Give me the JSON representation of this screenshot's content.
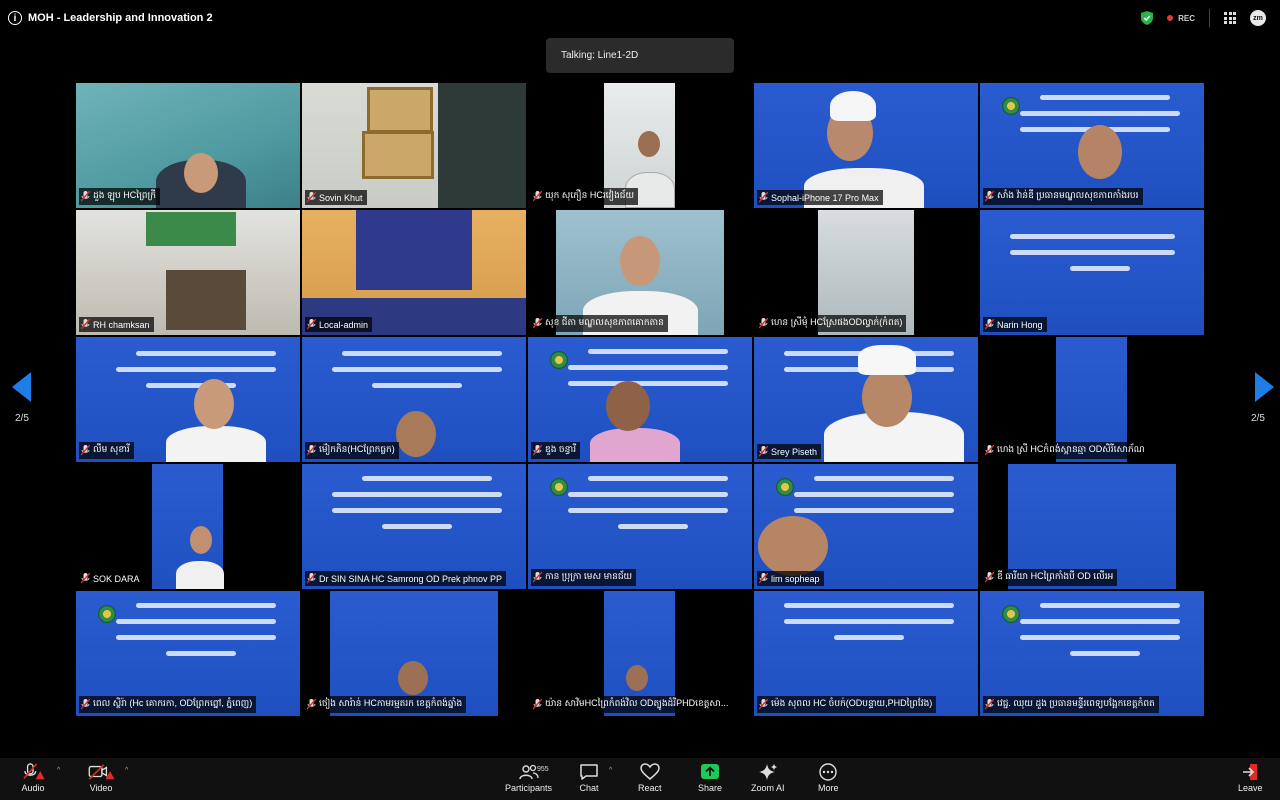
{
  "window": {
    "title": "MOH - Leadership and Innovation 2",
    "recording_label": "REC"
  },
  "talking": "Talking: Line1-2D",
  "pagination": {
    "left": "2/5",
    "right": "2/5"
  },
  "tiles": [
    "ដួង ឡុប HCព្រៃក្រី",
    "Sovin Khut",
    "យុក សុភឿន HCរវៀងជ័យ",
    "Sophal-iPhone 17 Pro Max",
    "សាំង វ៉ាន់ឌី ប្រធានមណ្ឌលសុខភាពកាំងរបរ",
    "RH chamksan",
    "Local-admin",
    "សុខ ជីតា មណ្ឌលសុខភាពគោកតាន",
    "ហេន ស្រីមុំ HCស្រែផងODល្វាក់(កំពត)",
    "Narin Hong",
    "លឹម សុខារី",
    "ម៉ៀកភិន(HCព្រែកធ្លក)",
    "ឌួង ចន្ធារី",
    "Srey Piseth",
    "ហេង ស្រី HCកំពង់ស្ពានឆ្មា ODសិរីសោភ័ណ",
    "SOK DARA",
    "Dr SIN SINA HC Samrong OD Prek phnov PP",
    "កាន ប្រុក្រា មេស មានជ័យ",
    "lim sopheap",
    "ឌី ធារីយា HCព្រៃកាំងបី OD លើរអ",
    "ពេល ស្ថិរ៉ា (Hc គោករកា, ODព្រែកព្នៅ, ភ្នំពេញ)",
    "ថៀង សារ៉ាន់ HCកាមរម្មតរក ខេត្តកំពង់ឆ្នាំង",
    "យ៉ាន សាវិមHCព្រៃកំពង់វិល ODត្បូងដំរីPHDខេត្តសា...",
    "ម៉េង សុពល HC ចំបក់(ODបន្ទាយ,PHDព្រៃវែង)",
    "វេជ្ជ. ឈុយ ដួង ប្រធានមន្ទីរពេទ្យបង្អែកខេត្តកំពត"
  ],
  "toolbar": {
    "audio": "Audio",
    "video": "Video",
    "participants": "Participants",
    "participant_count": "955",
    "chat": "Chat",
    "react": "React",
    "share": "Share",
    "zoom_ai": "Zoom AI",
    "more": "More",
    "leave": "Leave"
  },
  "colors": {
    "accent": "#1f7de8",
    "share": "#1ec95a",
    "rec": "#e23b3b",
    "mute": "#e02a2a"
  }
}
